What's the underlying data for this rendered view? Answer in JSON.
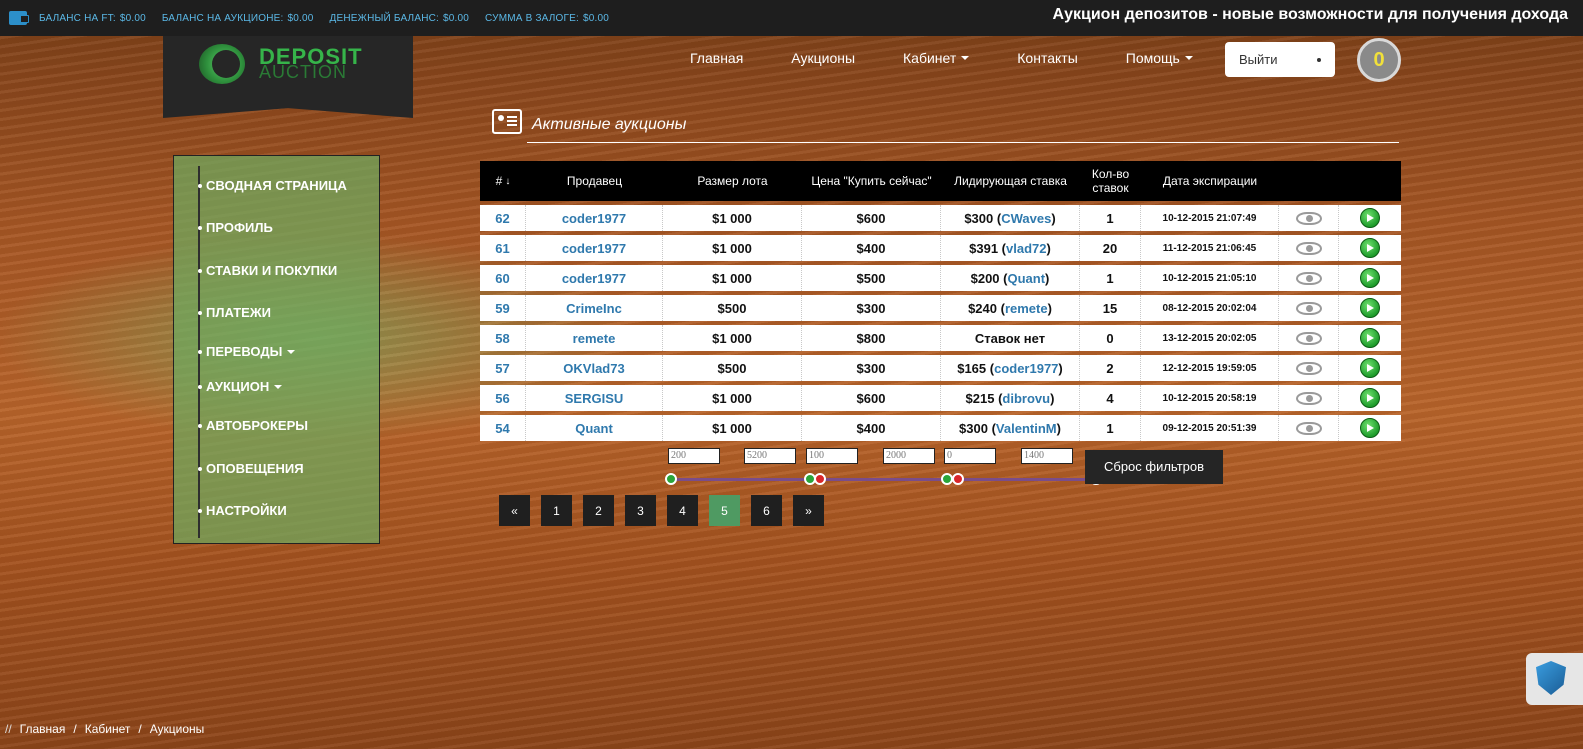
{
  "topbar": {
    "balances": [
      {
        "label": "БАЛАНС НА FT:",
        "value": "$0.00"
      },
      {
        "label": "БАЛАНС НА АУКЦИОНЕ:",
        "value": "$0.00"
      },
      {
        "label": "ДЕНЕЖНЫЙ БАЛАНС:",
        "value": "$0.00"
      },
      {
        "label": "СУММА В ЗАЛОГЕ:",
        "value": "$0.00"
      }
    ],
    "title": "Аукцион депозитов - новые возможности для получения дохода"
  },
  "logo": {
    "line1": "DEPOSIT",
    "line2": "AUCTION"
  },
  "nav": {
    "items": [
      "Главная",
      "Аукционы",
      "Кабинет",
      "Контакты",
      "Помощь"
    ],
    "logout": "Выйти",
    "coin_count": "0"
  },
  "sidebar": {
    "items": [
      "СВОДНАЯ СТРАНИЦА",
      "ПРОФИЛЬ",
      "СТАВКИ И ПОКУПКИ",
      "ПЛАТЕЖИ",
      "ПЕРЕВОДЫ",
      "АУКЦИОН",
      "АВТОБРОКЕРЫ",
      "ОПОВЕЩЕНИЯ",
      "НАСТРОЙКИ"
    ]
  },
  "section": {
    "title": "Активные аукционы"
  },
  "table": {
    "headers": [
      "#",
      "Продавец",
      "Размер лота",
      "Цена \"Купить сейчас\"",
      "Лидирующая ставка",
      "Кол-во ставок",
      "Дата экспирации"
    ],
    "rows": [
      {
        "id": "62",
        "seller": "coder1977",
        "lot": "$1 000",
        "buy": "$600",
        "bid": "$300",
        "bidder": "CWaves",
        "count": "1",
        "date": "10-12-2015 21:07:49"
      },
      {
        "id": "61",
        "seller": "coder1977",
        "lot": "$1 000",
        "buy": "$400",
        "bid": "$391",
        "bidder": "vlad72",
        "count": "20",
        "date": "11-12-2015 21:06:45"
      },
      {
        "id": "60",
        "seller": "coder1977",
        "lot": "$1 000",
        "buy": "$500",
        "bid": "$200",
        "bidder": "Quant",
        "count": "1",
        "date": "10-12-2015 21:05:10"
      },
      {
        "id": "59",
        "seller": "CrimeInc",
        "lot": "$500",
        "buy": "$300",
        "bid": "$240",
        "bidder": "remete",
        "count": "15",
        "date": "08-12-2015 20:02:04"
      },
      {
        "id": "58",
        "seller": "remete",
        "lot": "$1 000",
        "buy": "$800",
        "bid": "Ставок нет",
        "bidder": "",
        "count": "0",
        "date": "13-12-2015 20:02:05"
      },
      {
        "id": "57",
        "seller": "OKVlad73",
        "lot": "$500",
        "buy": "$300",
        "bid": "$165",
        "bidder": "coder1977",
        "count": "2",
        "date": "12-12-2015 19:59:05"
      },
      {
        "id": "56",
        "seller": "SERGISU",
        "lot": "$1 000",
        "buy": "$600",
        "bid": "$215",
        "bidder": "dibrovu",
        "count": "4",
        "date": "10-12-2015 20:58:19"
      },
      {
        "id": "54",
        "seller": "Quant",
        "lot": "$1 000",
        "buy": "$400",
        "bid": "$300",
        "bidder": "ValentinM",
        "count": "1",
        "date": "09-12-2015 20:51:39"
      }
    ]
  },
  "filters": {
    "lot_min": "200",
    "lot_max": "5200",
    "buy_min": "100",
    "buy_max": "2000",
    "bid_min": "0",
    "bid_max": "1400",
    "reset": "Сброс фильтров"
  },
  "pager": {
    "prev": "«",
    "pages": [
      "1",
      "2",
      "3",
      "4",
      "5",
      "6"
    ],
    "active": "5",
    "next": "»"
  },
  "breadcrumb": [
    "Главная",
    "Кабинет",
    "Аукционы"
  ]
}
